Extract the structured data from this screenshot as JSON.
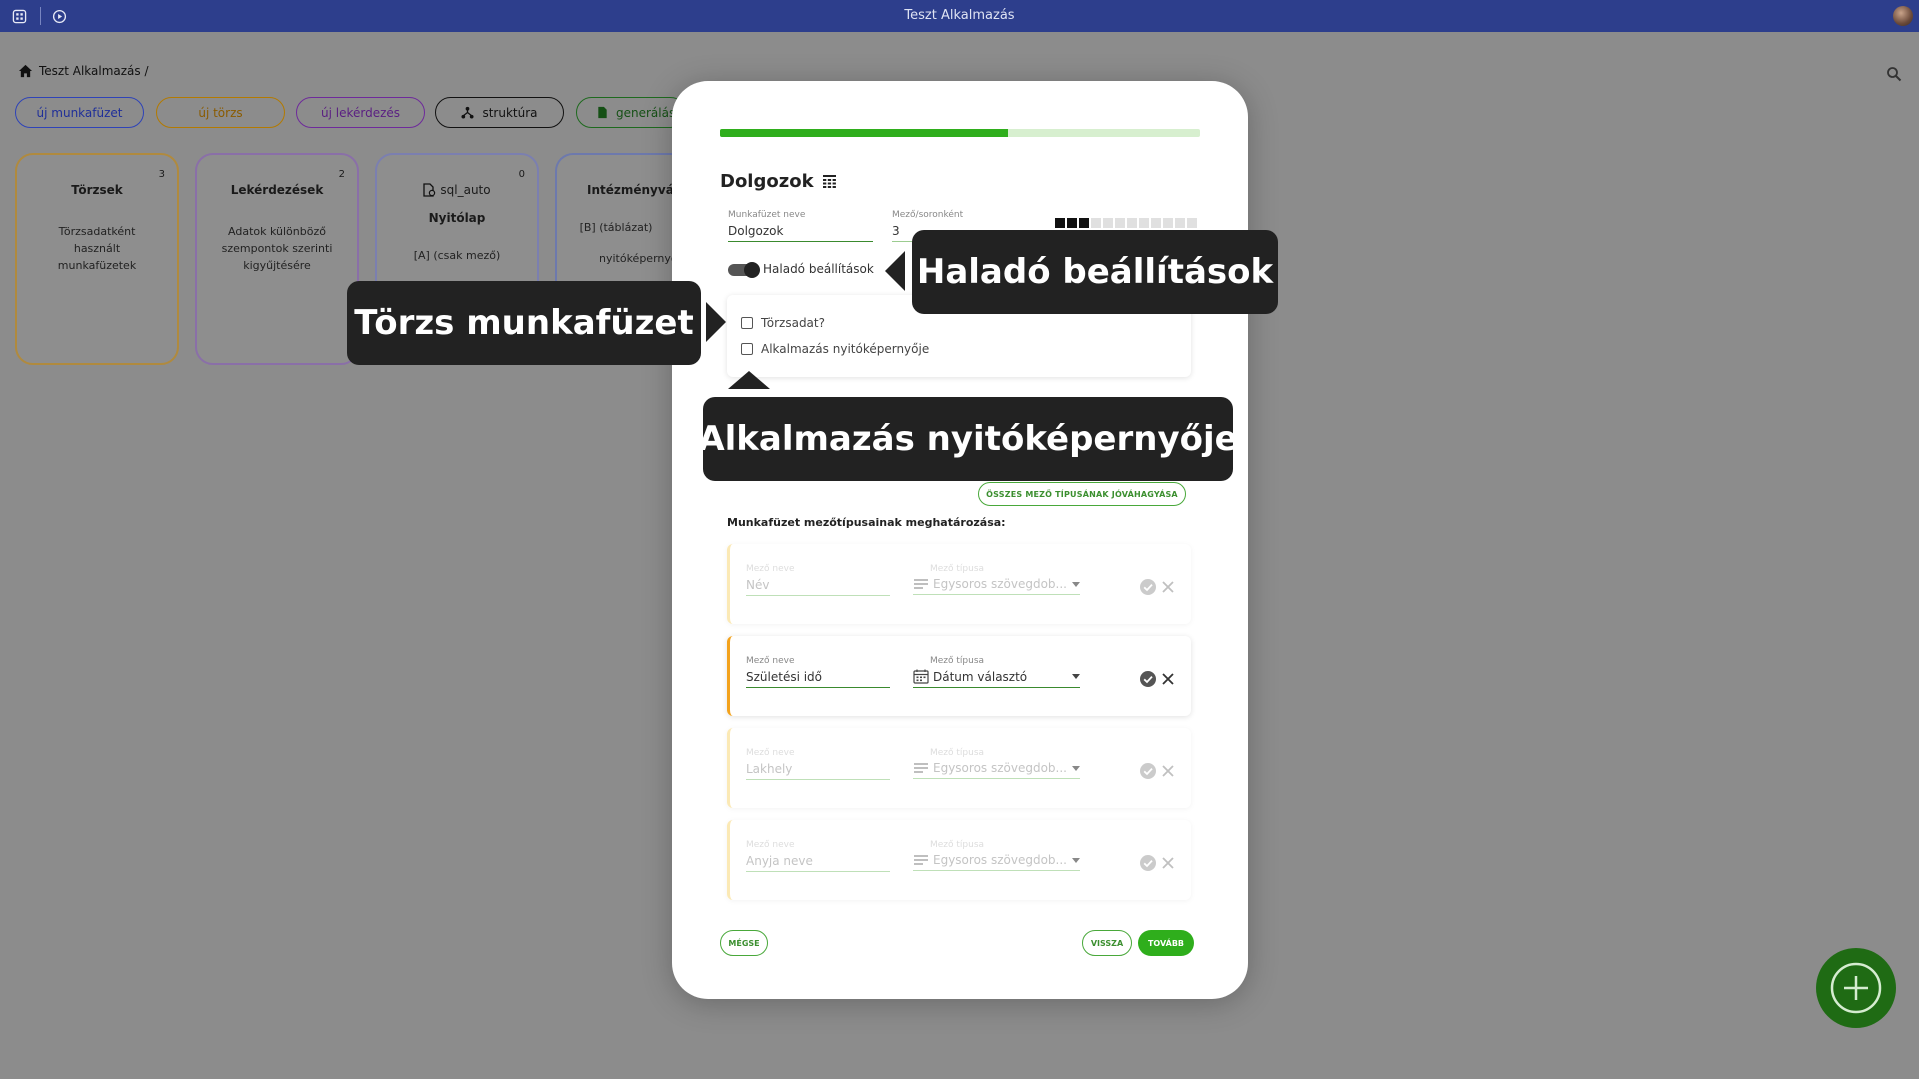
{
  "app": {
    "title": "Teszt Alkalmazás"
  },
  "breadcrumb": {
    "text": "Teszt Alkalmazás /"
  },
  "toolbar": {
    "new_workbook": "új munkafüzet",
    "new_master": "új törzs",
    "new_query": "új lekérdezés",
    "structure": "struktúra",
    "generate": "generálás"
  },
  "cards": [
    {
      "title": "Törzsek",
      "count": "3",
      "desc": "Törzsadatként használt munkafüzetek"
    },
    {
      "title": "Lekérdezések",
      "count": "2",
      "desc": "Adatok különböző szempontok szerinti kigyűjtésére"
    },
    {
      "title": "sql_auto",
      "count": "0",
      "subtitle": "Nyitólap",
      "desc": "[A] (csak mező)"
    },
    {
      "title": "Intézményválasz",
      "desc": "[B] (táblázat)",
      "desc2": "nyitóképernyő"
    }
  ],
  "modal": {
    "progress": 0.6,
    "title": "Dolgozok",
    "workbook_name_label": "Munkafüzet neve",
    "workbook_name_value": "Dolgozok",
    "fields_per_row_label": "Mező/soronként",
    "fields_per_row_value": "3",
    "fields_per_row_selected": 3,
    "fields_per_row_total": 12,
    "advanced_toggle_label": "Haladó beállítások",
    "advanced_toggle_on": true,
    "master_data_checkbox": "Törzsadat?",
    "start_screen_checkbox": "Alkalmazás nyitóképernyője",
    "confirm_all_button": "ÖSSZES MEZŐ TÍPUSÁNAK JÓVÁHAGYÁSA",
    "section_label": "Munkafüzet mezőtípusainak meghatározása:",
    "field_name_label": "Mező neve",
    "field_type_label": "Mező típusa",
    "fields": [
      {
        "name": "Név",
        "type": "Egysoros szövegdob...",
        "active": false
      },
      {
        "name": "Születési idő",
        "type": "Dátum választó",
        "active": true
      },
      {
        "name": "Lakhely",
        "type": "Egysoros szövegdob...",
        "active": false
      },
      {
        "name": "Anyja neve",
        "type": "Egysoros szövegdob...",
        "active": false
      }
    ],
    "cancel_button": "MÉGSE",
    "back_button": "VISSZA",
    "next_button": "TOVÁBB"
  },
  "tooltips": {
    "advanced": "Haladó beállítások",
    "master": "Törzs munkafüzet",
    "start_screen": "Alkalmazás nyitóképernyője"
  },
  "colors": {
    "topbar": "#2d3e8c",
    "accent_green": "#2fae1c",
    "tooltip_bg": "#222222",
    "active_row_border": "#f3a21c"
  }
}
